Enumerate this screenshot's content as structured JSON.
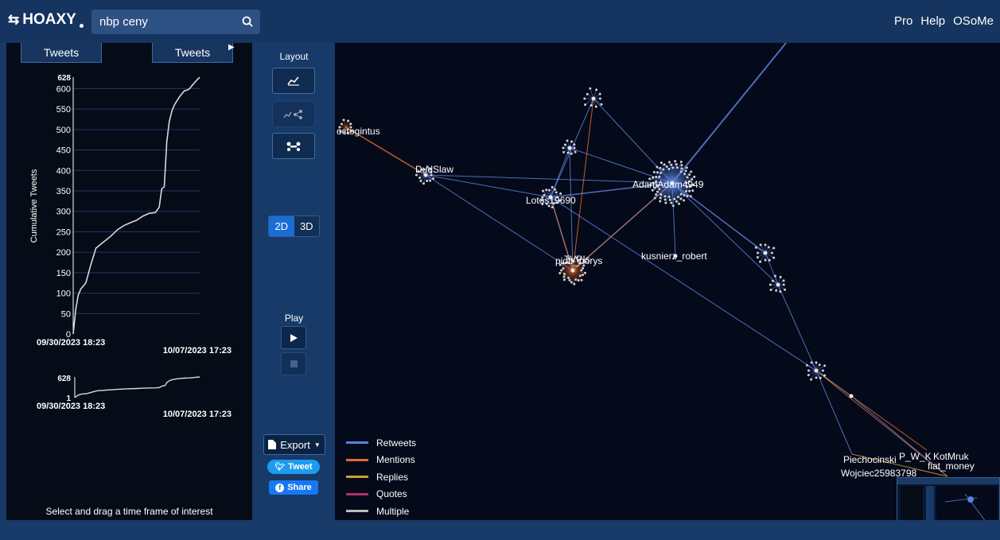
{
  "app": {
    "logo_text": "HOAXY",
    "search": {
      "value": "nbp ceny"
    },
    "nav": [
      "Pro",
      "Help",
      "OSoMe"
    ]
  },
  "timeline": {
    "left_button": "Tweets",
    "right_button": "Tweets",
    "ylabel": "Cumulative Tweets",
    "start_label": "09/30/2023 18:23",
    "end_label": "10/07/2023 17:23",
    "mini_top": "628",
    "mini_bottom": "1",
    "hint": "Select and drag a time frame of interest"
  },
  "chart_data": {
    "type": "line",
    "title": "",
    "xlabel": "",
    "ylabel": "Cumulative Tweets",
    "ylim": [
      0,
      628
    ],
    "yticks": [
      0,
      50,
      100,
      150,
      200,
      250,
      300,
      350,
      400,
      450,
      500,
      550,
      600,
      628
    ],
    "x_start": "09/30/2023 18:23",
    "x_end": "10/07/2023 17:23",
    "series": [
      {
        "x": [
          0.0,
          0.02,
          0.04,
          0.06,
          0.1,
          0.14,
          0.18,
          0.22,
          0.26,
          0.3,
          0.35,
          0.4,
          0.45,
          0.5,
          0.55,
          0.6,
          0.65,
          0.68,
          0.7,
          0.72,
          0.74,
          0.76,
          0.78,
          0.8,
          0.84,
          0.88,
          0.9,
          0.92,
          0.96,
          1.0
        ],
        "y": [
          0,
          60,
          95,
          110,
          125,
          170,
          210,
          220,
          230,
          240,
          255,
          265,
          272,
          278,
          288,
          295,
          297,
          310,
          355,
          360,
          470,
          520,
          545,
          560,
          580,
          595,
          596,
          600,
          615,
          628
        ]
      }
    ]
  },
  "controls": {
    "layout_label": "Layout",
    "mode_2d": "2D",
    "mode_3d": "3D",
    "play_label": "Play",
    "export_label": "Export",
    "tweet_label": "Tweet",
    "share_label": "Share"
  },
  "network": {
    "labels": [
      "octogintus",
      "DudSlaw",
      "Lotos19690",
      "AdamAdam4949",
      "TVPIs",
      "piotr_borys",
      "kusnierz_robert",
      "Piechocinski",
      "Wojciec25983798",
      "P_W_K",
      "KotMruk",
      "fiat_money"
    ],
    "colors": {
      "retweets": "#5b7fd6",
      "mentions": "#e06a2c",
      "replies": "#c9a02e",
      "quotes": "#b0306a",
      "multiple": "#bbbbbb"
    }
  },
  "legend": [
    {
      "label": "Retweets",
      "color": "#5b7fd6"
    },
    {
      "label": "Mentions",
      "color": "#e06a2c"
    },
    {
      "label": "Replies",
      "color": "#c9a02e"
    },
    {
      "label": "Quotes",
      "color": "#b0306a"
    },
    {
      "label": "Multiple",
      "color": "#bbbbbb"
    }
  ]
}
